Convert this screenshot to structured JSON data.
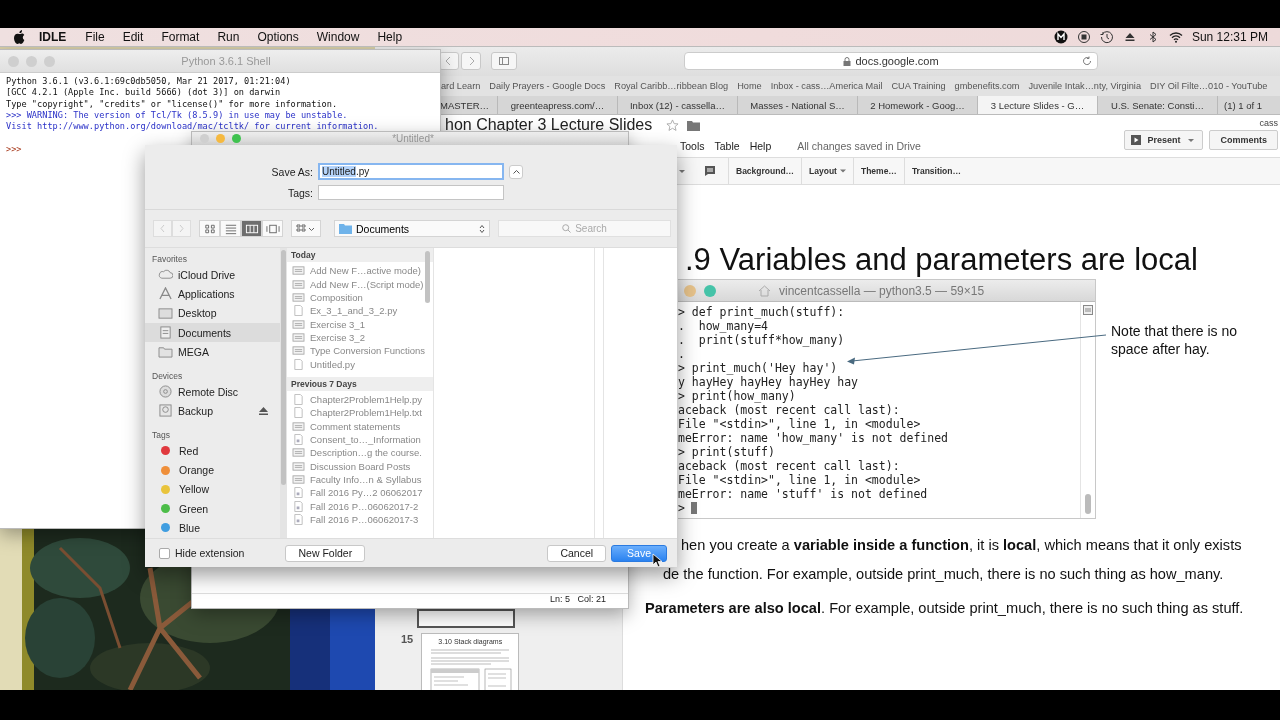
{
  "menubar": {
    "app": "IDLE",
    "menus": [
      "File",
      "Edit",
      "Format",
      "Run",
      "Options",
      "Window",
      "Help"
    ],
    "clock": "Sun 12:31 PM"
  },
  "browser": {
    "url": "docs.google.com",
    "bookmarks": [
      "ard Learn",
      "Daily Prayers - Google Docs",
      "Royal Caribb…ribbean Blog",
      "Home",
      "Inbox - cass…America Mail",
      "CUA Training",
      "gmbenefits.com",
      "Juvenile Intak…nty, Virginia",
      "DIY Oil Filte…010 - YouTube"
    ],
    "tabs": [
      {
        "label": "MASTER…",
        "selected": false
      },
      {
        "label": "greenteapress.com/…",
        "selected": false
      },
      {
        "label": "Inbox (12) - cassella…",
        "selected": false
      },
      {
        "label": "Masses - National S…",
        "selected": false
      },
      {
        "label": "2 Homework - Goog…",
        "selected": false
      },
      {
        "label": "3 Lecture Slides - G…",
        "selected": true
      },
      {
        "label": "U.S. Senate: Consti…",
        "selected": false
      },
      {
        "label": "(1) 1 of 1",
        "selected": false
      }
    ],
    "doc_title": "hon Chapter 3 Lecture Slides",
    "user": "cass",
    "menus": [
      "Tools",
      "Table",
      "Help"
    ],
    "save_status": "All changes saved in Drive",
    "toolbar": [
      "Background…",
      "Layout",
      "Theme…",
      "Transition…"
    ],
    "present": "Present",
    "comments": "Comments",
    "filmstrip": {
      "number": "15",
      "thumbnail_title": "3.10 Stack diagrams"
    },
    "slide": {
      "title": ".9 Variables and parameters are local",
      "terminal": {
        "title": "vincentcassella — python3.5 — 59×15",
        "lines": [
          "> def print_much(stuff):",
          ".  how_many=4",
          ".  print(stuff*how_many)",
          ".",
          "> print_much('Hey hay')",
          "y hayHey hayHey hayHey hay",
          "> print(how_many)",
          "aceback (most recent call last):",
          "File \"<stdin>\", line 1, in <module>",
          "meError: name 'how_many' is not defined",
          "> print(stuff)",
          "aceback (most recent call last):",
          "File \"<stdin>\", line 1, in <module>",
          "meError: name 'stuff' is not defined",
          ">"
        ]
      },
      "note": "Note that there is no space after hay.",
      "lines": [
        "hen you create a **variable inside a function**, it is **local**, which means that it only exists",
        "de the function. For example, outside print_much, there is no such thing as how_many."
      ],
      "paragraph": "**Parameters are also local**. For example, outside print_much, there is no such thing as stuff."
    }
  },
  "shell": {
    "title": "Python 3.6.1 Shell",
    "active": false,
    "lines": [
      {
        "text": "Python 3.6.1 (v3.6.1:69c0db5050, Mar 21 2017, 01:21:04)",
        "kind": "output"
      },
      {
        "text": "[GCC 4.2.1 (Apple Inc. build 5666) (dot 3)] on darwin",
        "kind": "output"
      },
      {
        "text": "Type \"copyright\", \"credits\" or \"license()\" for more information.",
        "kind": "output"
      },
      {
        "text": ">>> WARNING: The version of Tcl/Tk (8.5.9) in use may be unstable.",
        "kind": "warning"
      },
      {
        "text": "Visit http://www.python.org/download/mac/tcltk/ for current information.",
        "kind": "warning"
      }
    ],
    "prompt": ">>>"
  },
  "editor": {
    "title": "*Untitled*",
    "active": true,
    "status": "Ln: 5   Col: 21"
  },
  "dialog": {
    "save_as_label": "Save As:",
    "file_name": "Untitled.py",
    "tags_label": "Tags:",
    "views": [
      {
        "kind": "icons",
        "selected": false
      },
      {
        "kind": "list",
        "selected": false
      },
      {
        "kind": "columns",
        "selected": true
      },
      {
        "kind": "flow",
        "selected": false
      }
    ],
    "location": "Documents",
    "search_placeholder": "Search",
    "sidebar": [
      {
        "title": "Favorites",
        "items": [
          {
            "label": "iCloud Drive",
            "kind": "cloud",
            "selected": false,
            "ejectable": false
          },
          {
            "label": "Applications",
            "kind": "apps",
            "selected": false,
            "ejectable": false
          },
          {
            "label": "Desktop",
            "kind": "desktop",
            "selected": false,
            "ejectable": false
          },
          {
            "label": "Documents",
            "kind": "documents",
            "selected": true,
            "ejectable": false
          },
          {
            "label": "MEGA",
            "kind": "folder",
            "selected": false,
            "ejectable": false
          }
        ]
      },
      {
        "title": "Devices",
        "items": [
          {
            "label": "Remote Disc",
            "kind": "disc",
            "selected": false,
            "ejectable": false
          },
          {
            "label": "Backup",
            "kind": "backup",
            "selected": false,
            "ejectable": true
          }
        ]
      },
      {
        "title": "Tags",
        "items": [
          {
            "label": "Red",
            "kind": "tag",
            "color": "#e0393e",
            "selected": false,
            "ejectable": false
          },
          {
            "label": "Orange",
            "kind": "tag",
            "color": "#ef8f3a",
            "selected": false,
            "ejectable": false
          },
          {
            "label": "Yellow",
            "kind": "tag",
            "color": "#e9c43c",
            "selected": false,
            "ejectable": false
          },
          {
            "label": "Green",
            "kind": "tag",
            "color": "#4cbd48",
            "selected": false,
            "ejectable": false
          },
          {
            "label": "Blue",
            "kind": "tag",
            "color": "#3f9de0",
            "selected": false,
            "ejectable": false
          }
        ]
      }
    ],
    "groups": [
      {
        "title": "Today",
        "items": [
          {
            "name": "Add New F…active mode)",
            "kind": "doc"
          },
          {
            "name": "Add New F…(Script mode)",
            "kind": "doc"
          },
          {
            "name": "Composition",
            "kind": "doc"
          },
          {
            "name": "Ex_3_1_and_3_2.py",
            "kind": "file"
          },
          {
            "name": "Exercise 3_1",
            "kind": "doc"
          },
          {
            "name": "Exercise 3_2",
            "kind": "doc"
          },
          {
            "name": "Type Conversion Functions",
            "kind": "doc"
          },
          {
            "name": "Untitled.py",
            "kind": "file"
          }
        ]
      },
      {
        "title": "Previous 7 Days",
        "items": [
          {
            "name": "Chapter2Problem1Help.py",
            "kind": "file"
          },
          {
            "name": "Chapter2Problem1Help.txt",
            "kind": "file"
          },
          {
            "name": "Comment statements",
            "kind": "doc"
          },
          {
            "name": "Consent_to…_Information",
            "kind": "pdf"
          },
          {
            "name": "Description…g the course.",
            "kind": "doc"
          },
          {
            "name": "Discussion Board Posts",
            "kind": "doc"
          },
          {
            "name": "Faculty Info…n & Syllabus",
            "kind": "doc"
          },
          {
            "name": "Fall 2016 Py…2 06062017",
            "kind": "pdf"
          },
          {
            "name": "Fall 2016 P…06062017-2",
            "kind": "pdf"
          },
          {
            "name": "Fall 2016 P…06062017-3",
            "kind": "pdf"
          }
        ]
      }
    ],
    "hide_extension": {
      "label": "Hide extension",
      "checked": false
    },
    "buttons": [
      {
        "label": "New Folder",
        "kind": "plain"
      },
      {
        "label": "Cancel",
        "kind": "plain"
      },
      {
        "label": "Save",
        "kind": "default"
      }
    ]
  }
}
